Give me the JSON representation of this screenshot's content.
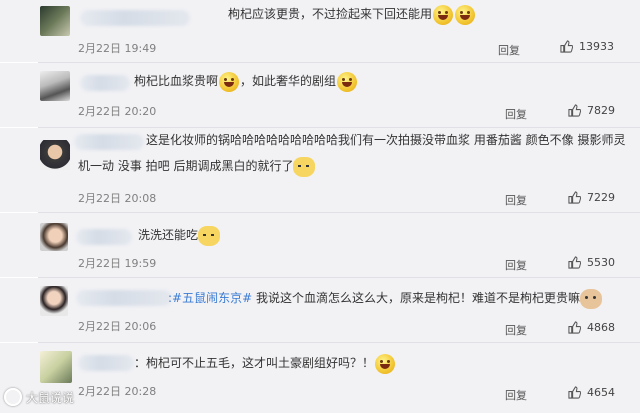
{
  "comments": [
    {
      "text_before": "枸杞应该更贵，不过捡起来下回还能用",
      "date": "2月22日 19:49",
      "reply_label": "回复",
      "likes": "13933"
    },
    {
      "text_before": "枸杞比血浆贵啊",
      "text_after": "，如此奢华的剧组",
      "date": "2月22日 20:20",
      "reply_label": "回复",
      "likes": "7829"
    },
    {
      "text_line1": "这是化妆师的锅哈哈哈哈哈哈哈哈哈我们有一次拍摄没带血浆 用番茄酱 颜色不像 摄影师灵",
      "text_line2": "机一动 没事 拍吧 后期调成黑白的就行了",
      "date": "2月22日 20:08",
      "reply_label": "回复",
      "likes": "7229"
    },
    {
      "text_before": "洗洗还能吃",
      "date": "2月22日 19:59",
      "reply_label": "回复",
      "likes": "5530"
    },
    {
      "topic": ":#五鼠闹东京#",
      "text_after": " 我说这个血滴怎么这么大，原来是枸杞！难道不是枸杞更贵嘛",
      "date": "2月22日 20:06",
      "reply_label": "回复",
      "likes": "4868"
    },
    {
      "text_before": "：枸杞可不止五毛，这才叫土豪剧组好吗？！",
      "date": "2月22日 20:28",
      "reply_label": "回复",
      "likes": "4654"
    }
  ],
  "watermark": "大鼠说说",
  "colors": {
    "background": "#f2f2f5",
    "topic": "#3a7cd4",
    "date": "#808080"
  }
}
